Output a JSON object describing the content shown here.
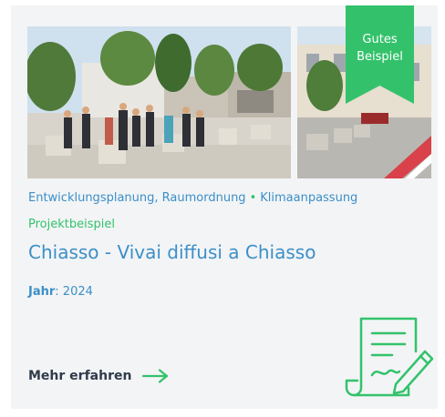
{
  "card": {
    "ribbon": {
      "line1": "Gutes",
      "line2": "Beispiel"
    },
    "tags": [
      "Entwicklungsplanung, Raumordnung",
      "Klimaanpassung"
    ],
    "tag_separator": "•",
    "type_label": "Projektbeispiel",
    "title": "Chiasso - Vivai diffusi a Chiasso",
    "year_label": "Jahr",
    "year_value": "2024",
    "more_label": "Mehr erfahren",
    "icons": {
      "arrow": "arrow-right-icon",
      "document": "document-edit-icon"
    },
    "colors": {
      "accent_green": "#33c26b",
      "link_blue": "#3b8fc8",
      "card_bg": "#f3f4f6",
      "text_dark": "#2e3b4a"
    }
  }
}
